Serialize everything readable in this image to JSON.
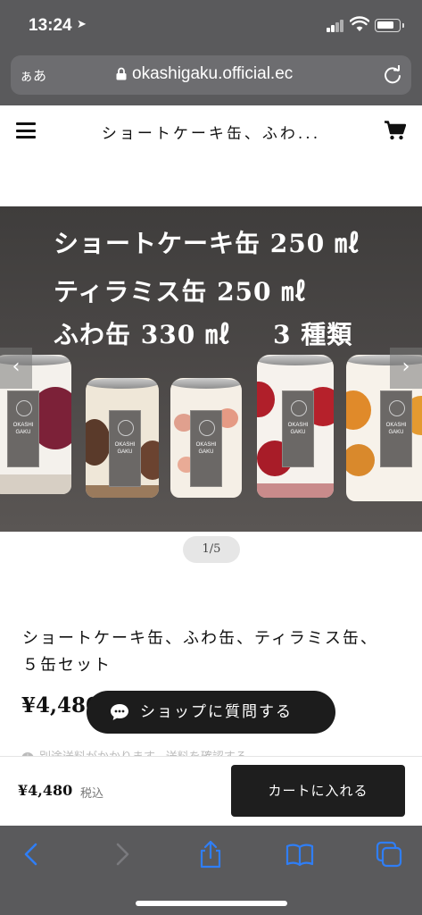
{
  "status_bar": {
    "time": "13:24"
  },
  "address_bar": {
    "text_size_label": "ぁあ",
    "url": "okashigaku.official.ec"
  },
  "header": {
    "title": "ショートケーキ缶、ふわ..."
  },
  "hero": {
    "lines": [
      "ショートケーキ缶 250 ㎖",
      "ティラミス缶 250 ㎖",
      "ふわ缶 330 ㎖",
      "3 種類"
    ],
    "can_label_text": "OKASHI GAKU",
    "prev_arrow": "‹",
    "next_arrow": "›",
    "pager": "1/5"
  },
  "product": {
    "title": "ショートケーキ缶、ふわ缶、ティラミス缶、５缶セット",
    "price": "¥4,480",
    "shipping_note": "別途送料がかかります。送料を確認する"
  },
  "chat": {
    "label": "ショップに質問する"
  },
  "buy_bar": {
    "price": "¥4,480",
    "tax_label": "税込",
    "add_to_cart": "カートに入れる"
  },
  "colors": {
    "chrome": "#5a5a5c",
    "toolbar_icon": "#2f7ef6",
    "dark_button": "#1e1e1e"
  }
}
